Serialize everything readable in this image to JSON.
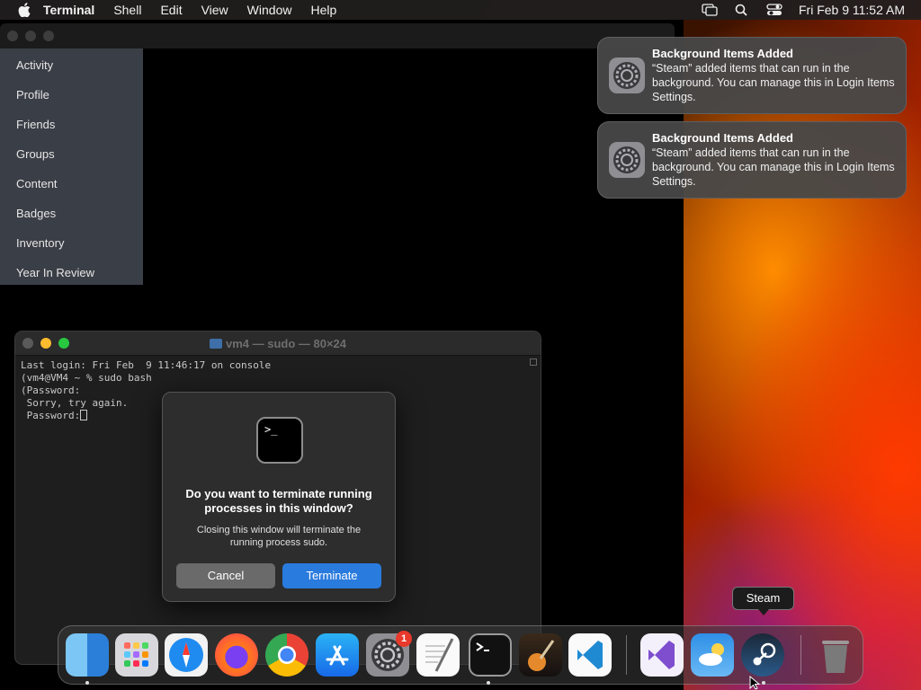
{
  "menubar": {
    "app_name": "Terminal",
    "menus": [
      "Shell",
      "Edit",
      "View",
      "Window",
      "Help"
    ],
    "clock": "Fri Feb 9  11:52 AM"
  },
  "steam_menu": {
    "items": [
      "Activity",
      "Profile",
      "Friends",
      "Groups",
      "Content",
      "Badges",
      "Inventory",
      "Year In Review"
    ]
  },
  "terminal": {
    "title": "vm4 — sudo — 80×24",
    "lines": [
      "Last login: Fri Feb  9 11:46:17 on console",
      "(vm4@VM4 ~ % sudo bash",
      "(Password:",
      " Sorry, try again.",
      " Password:"
    ]
  },
  "dialog": {
    "icon_text": ">_",
    "title": "Do you want to terminate running processes in this window?",
    "message": "Closing this window will terminate the running process sudo.",
    "cancel_label": "Cancel",
    "terminate_label": "Terminate"
  },
  "notifications": [
    {
      "title": "Background Items Added",
      "body": "“Steam” added items that can run in the background. You can manage this in Login Items Settings."
    },
    {
      "title": "Background Items Added",
      "body": "“Steam” added items that can run in the background. You can manage this in Login Items Settings."
    }
  ],
  "dock": {
    "apps": [
      "finder-icon",
      "launchpad-icon",
      "safari-icon",
      "firefox-icon",
      "chrome-icon",
      "app-store-icon",
      "system-settings-icon",
      "textedit-icon",
      "terminal-icon",
      "garageband-icon",
      "vscode-icon",
      "visual-studio-icon",
      "weather-icon",
      "steam-icon",
      "trash-icon"
    ],
    "settings_badge": "1",
    "tooltip": "Steam"
  },
  "colors": {
    "accent_button": "#2a7bde",
    "badge": "#e8392b"
  }
}
